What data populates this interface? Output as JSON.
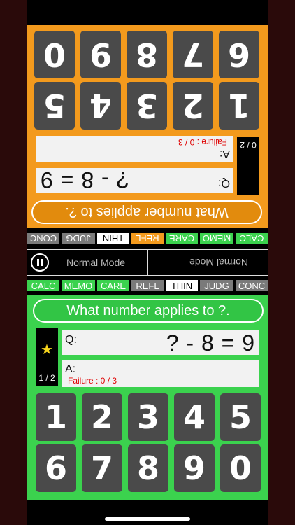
{
  "bottom": {
    "prompt": "What number applies to ?.",
    "question_label": "Q:",
    "equation": "? - 8 = 9",
    "answer_label": "A:",
    "failure": "Failure : 0 / 3",
    "progress": "1 / 2",
    "star": "★",
    "keys": [
      "1",
      "2",
      "3",
      "4",
      "5",
      "6",
      "7",
      "8",
      "9",
      "0"
    ]
  },
  "top": {
    "prompt": "What number applies to ?.",
    "question_label": "Q:",
    "equation": "? - 8 = 9",
    "answer_label": "A:",
    "failure": "Failure : 0 / 3",
    "progress": "0 / 2",
    "keys": [
      "1",
      "2",
      "3",
      "4",
      "5",
      "6",
      "7",
      "8",
      "9",
      "0"
    ]
  },
  "modes_top": [
    "CALC",
    "MEMO",
    "CARE",
    "REFL",
    "THIN",
    "JUDG",
    "CONC"
  ],
  "modes_bottom": [
    "CALC",
    "MEMO",
    "CARE",
    "REFL",
    "THIN",
    "JUDG",
    "CONC"
  ],
  "status": {
    "left_mode": "Normal Mode",
    "right_mode": "Normal Mode"
  },
  "colors": {
    "orange": "#f39a1d",
    "green": "#3bd24e",
    "gray": "#7a7a7a",
    "failure": "#e00000"
  }
}
